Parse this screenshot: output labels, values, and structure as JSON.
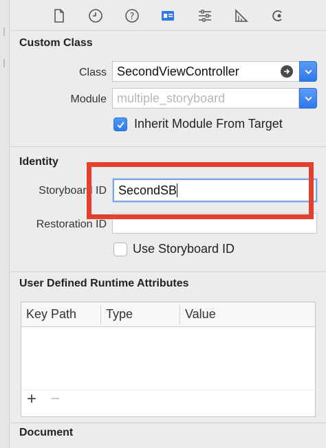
{
  "toolbar": {
    "icons": [
      "file-icon",
      "history-icon",
      "help-icon",
      "identity-icon",
      "attributes-icon",
      "size-icon",
      "connections-icon"
    ],
    "selected": "identity-icon",
    "accent": "#2f79ec"
  },
  "custom_class": {
    "title": "Custom Class",
    "class_label": "Class",
    "class_value": "SecondViewController",
    "module_label": "Module",
    "module_placeholder": "multiple_storyboard",
    "inherit_checked": true,
    "inherit_label": "Inherit Module From Target"
  },
  "identity": {
    "title": "Identity",
    "storyboard_id_label": "Storyboard ID",
    "storyboard_id_value": "SecondSB",
    "restoration_id_label": "Restoration ID",
    "restoration_id_value": "",
    "use_storyboard_id_checked": false,
    "use_storyboard_id_label": "Use Storyboard ID"
  },
  "runtime_attrs": {
    "title": "User Defined Runtime Attributes",
    "columns": [
      "Key Path",
      "Type",
      "Value"
    ],
    "rows": [],
    "add_symbol": "+",
    "remove_symbol": "−"
  },
  "document": {
    "title": "Document"
  },
  "annotation": {
    "highlight_color": "#e2412f"
  }
}
